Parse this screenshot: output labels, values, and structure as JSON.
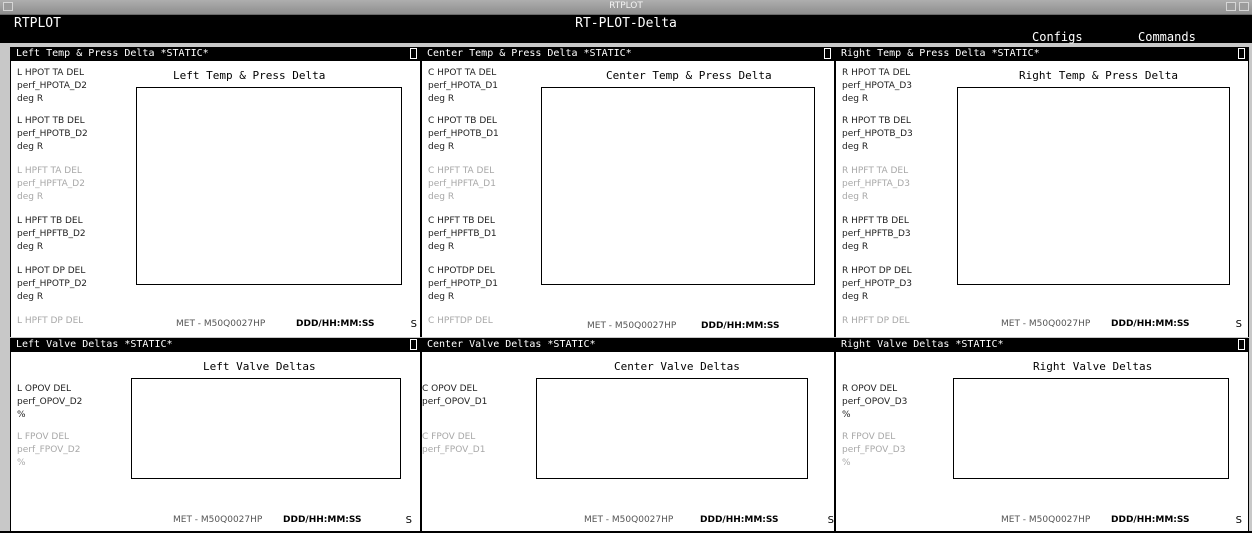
{
  "window": {
    "title": "RTPLOT"
  },
  "menubar": {
    "app_name": "RTPLOT",
    "display_name": "RT-PLOT-Delta",
    "menus": [
      "Configs",
      "Commands"
    ]
  },
  "footer": {
    "met": "MET - M50Q0027HP",
    "time_format": "DDD/HH:MM:SS",
    "suffix": "S"
  },
  "panels": {
    "left_temp": {
      "header": "Left Temp & Press Delta *STATIC*",
      "title": "Left Temp & Press Delta",
      "params": [
        {
          "name": "L HPOT TA DEL",
          "var": "perf_HPOTA_D2",
          "unit": "deg R"
        },
        {
          "name": "L HPOT TB DEL",
          "var": "perf_HPOTB_D2",
          "unit": "deg R"
        },
        {
          "name": "L HPFT TA DEL",
          "var": "perf_HPFTA_D2",
          "unit": "deg R"
        },
        {
          "name": "L HPFT TB DEL",
          "var": "perf_HPFTB_D2",
          "unit": "deg R"
        },
        {
          "name": "L HPOT DP DEL",
          "var": "perf_HPOTP_D2",
          "unit": "deg R"
        },
        {
          "name": "L HPFT DP DEL",
          "var": "",
          "unit": ""
        }
      ]
    },
    "center_temp": {
      "header": "Center Temp & Press Delta *STATIC*",
      "title": "Center Temp & Press Delta",
      "params": [
        {
          "name": "C HPOT TA DEL",
          "var": "perf_HPOTA_D1",
          "unit": "deg R"
        },
        {
          "name": "C HPOT TB DEL",
          "var": "perf_HPOTB_D1",
          "unit": "deg R"
        },
        {
          "name": "C HPFT TA DEL",
          "var": "perf_HPFTA_D1",
          "unit": "deg R"
        },
        {
          "name": "C HPFT TB DEL",
          "var": "perf_HPFTB_D1",
          "unit": "deg R"
        },
        {
          "name": "C HPOTDP DEL",
          "var": "perf_HPOTP_D1",
          "unit": "deg R"
        },
        {
          "name": "C HPFTDP DEL",
          "var": "",
          "unit": ""
        }
      ]
    },
    "right_temp": {
      "header": "Right Temp & Press Delta *STATIC*",
      "title": "Right Temp & Press Delta",
      "params": [
        {
          "name": "R HPOT TA DEL",
          "var": "perf_HPOTA_D3",
          "unit": "deg R"
        },
        {
          "name": "R HPOT TB DEL",
          "var": "perf_HPOTB_D3",
          "unit": "deg R"
        },
        {
          "name": "R HPFT TA DEL",
          "var": "perf_HPFTA_D3",
          "unit": "deg R"
        },
        {
          "name": "R HPFT TB DEL",
          "var": "perf_HPFTB_D3",
          "unit": "deg R"
        },
        {
          "name": "R HPOT DP DEL",
          "var": "perf_HPOTP_D3",
          "unit": "deg R"
        },
        {
          "name": "R HPFT DP DEL",
          "var": "",
          "unit": ""
        }
      ]
    },
    "left_valve": {
      "header": "Left Valve Deltas *STATIC*",
      "title": "Left Valve Deltas",
      "params": [
        {
          "name": "L OPOV DEL",
          "var": "perf_OPOV_D2",
          "unit": "%"
        },
        {
          "name": "L FPOV DEL",
          "var": "perf_FPOV_D2",
          "unit": "%"
        }
      ]
    },
    "center_valve": {
      "header": "Center Valve Deltas *STATIC*",
      "title": "Center Valve Deltas",
      "params": [
        {
          "name": "C OPOV DEL",
          "var": "perf_OPOV_D1",
          "unit": ""
        },
        {
          "name": "C FPOV DEL",
          "var": "perf_FPOV_D1",
          "unit": ""
        }
      ]
    },
    "right_valve": {
      "header": "Right Valve Deltas *STATIC*",
      "title": "Right Valve Deltas",
      "params": [
        {
          "name": "R OPOV DEL",
          "var": "perf_OPOV_D3",
          "unit": "%"
        },
        {
          "name": "R FPOV DEL",
          "var": "perf_FPOV_D3",
          "unit": "%"
        }
      ]
    }
  }
}
